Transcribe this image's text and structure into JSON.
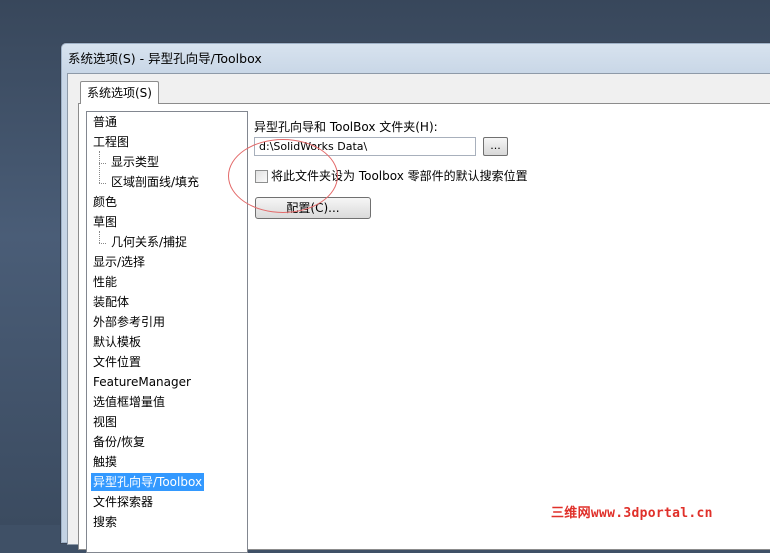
{
  "window": {
    "title": "系统选项(S) - 异型孔向导/Toolbox"
  },
  "tabs": [
    {
      "label": "系统选项(S)"
    }
  ],
  "tree": {
    "items": [
      {
        "label": "普通"
      },
      {
        "label": "工程图"
      },
      {
        "label": "显示类型",
        "child": true
      },
      {
        "label": "区域剖面线/填充",
        "child": true
      },
      {
        "label": "颜色"
      },
      {
        "label": "草图"
      },
      {
        "label": "几何关系/捕捉",
        "child": true
      },
      {
        "label": "显示/选择"
      },
      {
        "label": "性能"
      },
      {
        "label": "装配体"
      },
      {
        "label": "外部参考引用"
      },
      {
        "label": "默认模板"
      },
      {
        "label": "文件位置"
      },
      {
        "label": "FeatureManager"
      },
      {
        "label": "选值框增量值"
      },
      {
        "label": "视图"
      },
      {
        "label": "备份/恢复"
      },
      {
        "label": "触摸"
      },
      {
        "label": "异型孔向导/Toolbox",
        "selected": true
      },
      {
        "label": "文件探索器"
      },
      {
        "label": "搜索"
      }
    ]
  },
  "panel": {
    "folder_label": "异型孔向导和 ToolBox 文件夹(H):",
    "folder_value": "d:\\SolidWorks Data\\",
    "browse_label": "...",
    "default_checkbox_label": "将此文件夹设为 Toolbox 零部件的默认搜索位置",
    "default_checkbox_checked": false,
    "config_button_label": "配置(C)..."
  },
  "watermark": "三维网www.3dportal.cn",
  "colors": {
    "selection": "#3399ff",
    "annotation_circle": "#e36a6a",
    "watermark": "#e0302a"
  }
}
